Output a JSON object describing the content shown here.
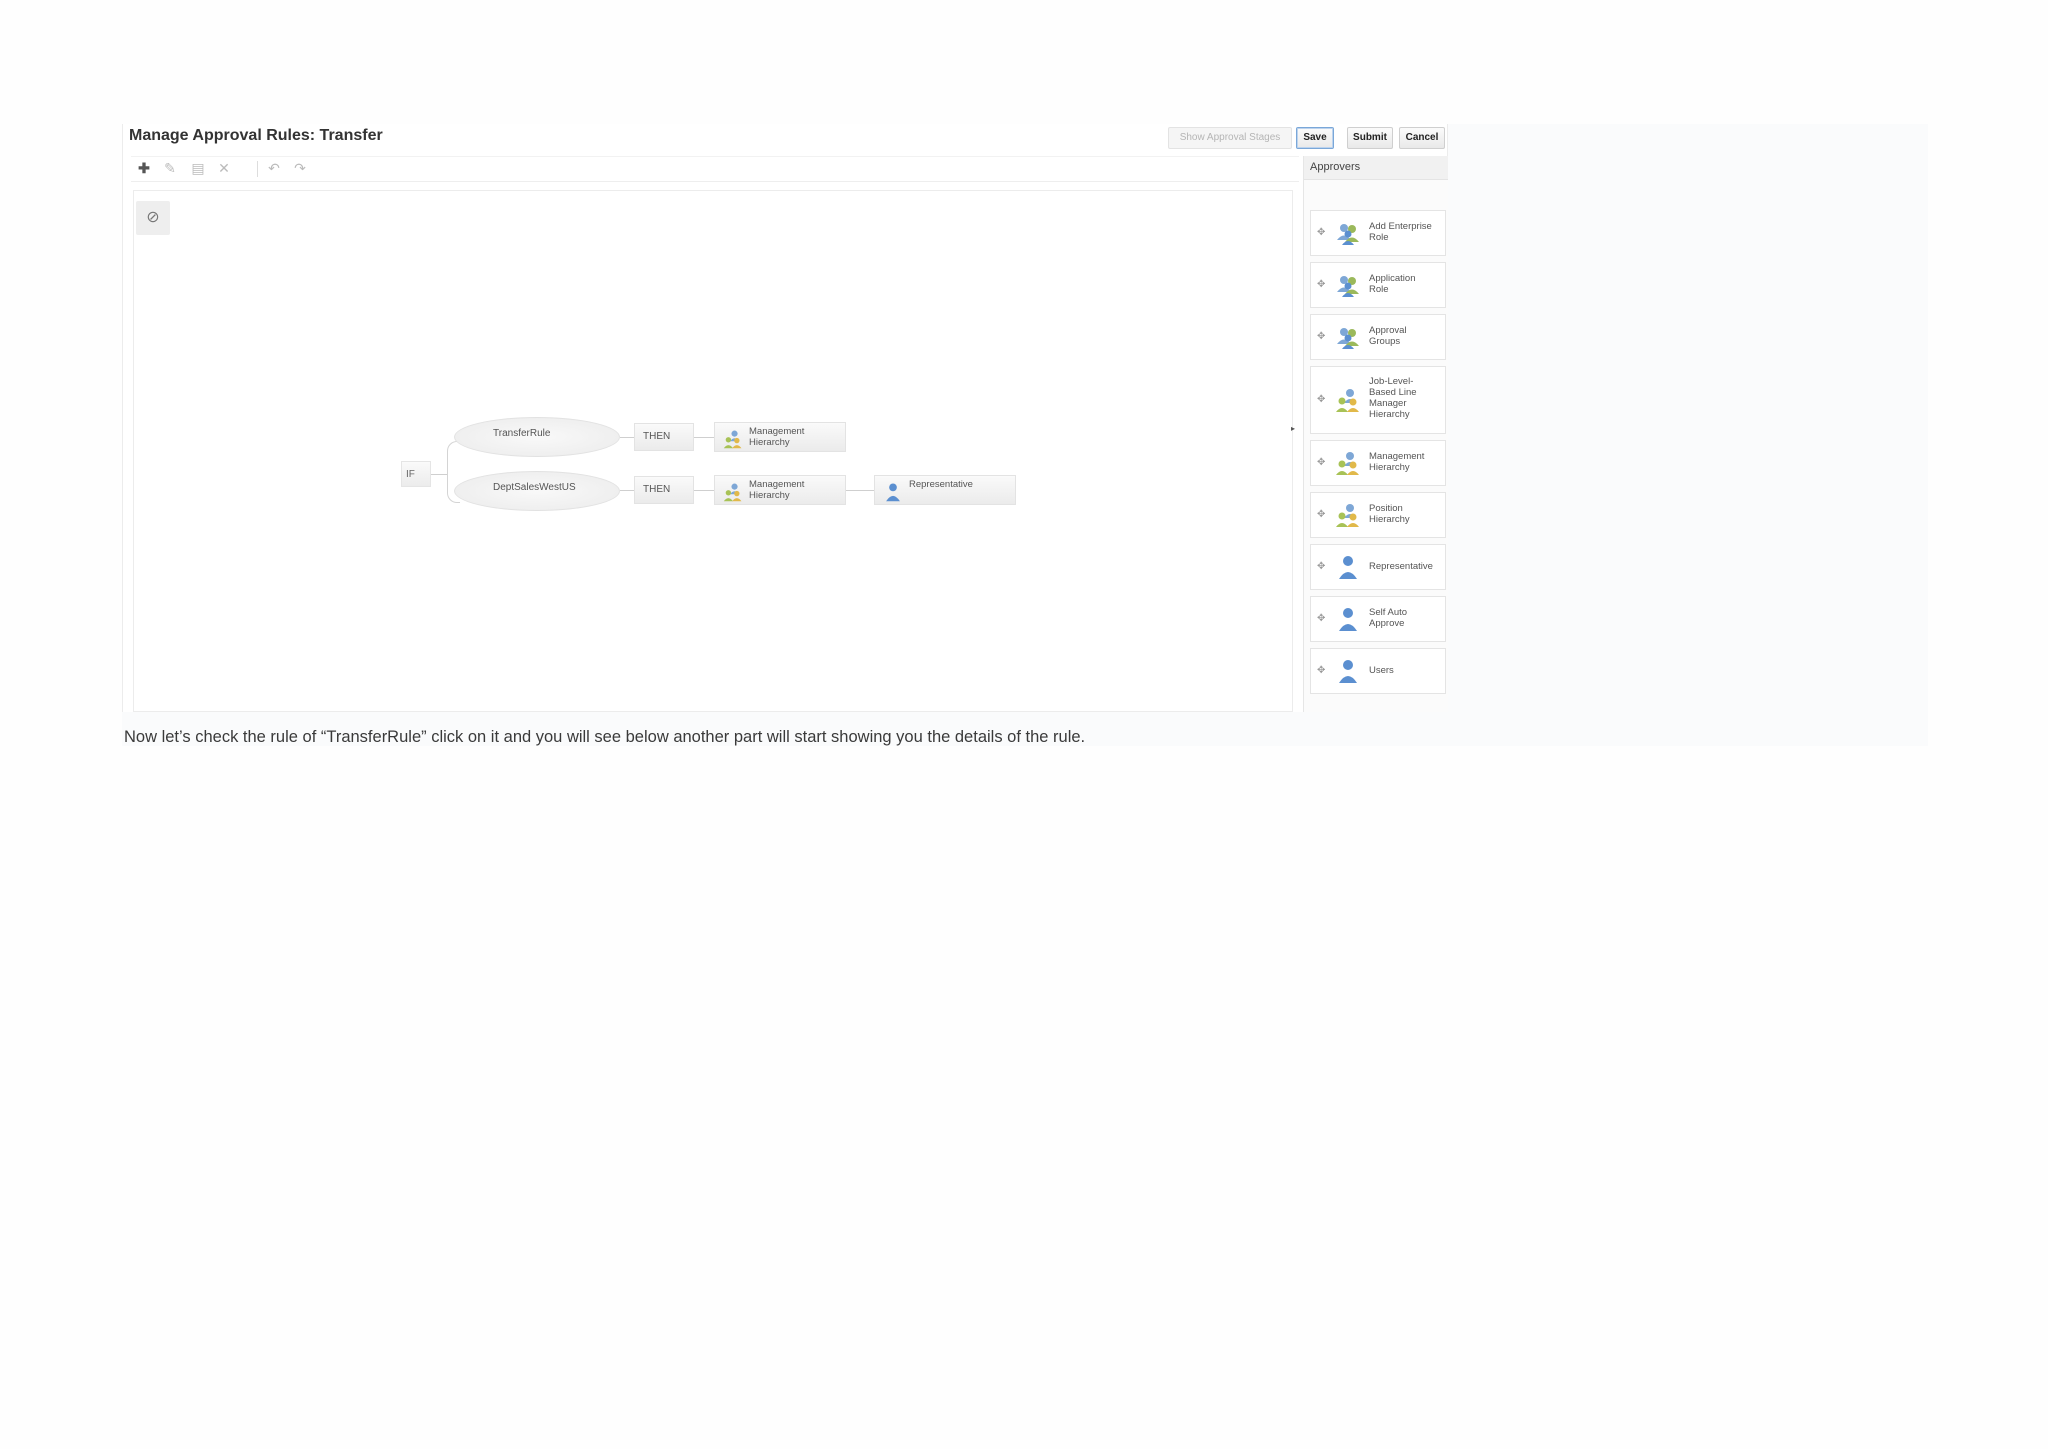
{
  "window": {
    "title": "Manage Approval Rules: Transfer"
  },
  "header_buttons": {
    "show_stages": "Show Approval Stages",
    "save": "Save",
    "submit": "Submit",
    "cancel": "Cancel"
  },
  "toolbar": {
    "icons": [
      "add-icon",
      "edit-icon",
      "copy-icon",
      "delete-icon",
      "undo-icon",
      "redo-icon"
    ]
  },
  "canvas": {
    "if_label": "IF",
    "rules": [
      {
        "name": "TransferRule",
        "then": "THEN",
        "approvers": [
          "Management\nHierarchy"
        ]
      },
      {
        "name": "DeptSalesWestUS",
        "then": "THEN",
        "approvers": [
          "Management\nHierarchy",
          "Representative"
        ]
      }
    ]
  },
  "approvers_panel": {
    "title": "Approvers",
    "items": [
      {
        "label": "Add Enterprise\nRole",
        "icon": "group-icon"
      },
      {
        "label": "Application\nRole",
        "icon": "group-icon"
      },
      {
        "label": "Approval\nGroups",
        "icon": "group-icon"
      },
      {
        "label": "Job-Level-\nBased Line\nManager\nHierarchy",
        "icon": "hierarchy-icon"
      },
      {
        "label": "Management\nHierarchy",
        "icon": "hierarchy-icon"
      },
      {
        "label": "Position\nHierarchy",
        "icon": "hierarchy-icon"
      },
      {
        "label": "Representative",
        "icon": "person-icon"
      },
      {
        "label": "Self Auto\nApprove",
        "icon": "person-icon"
      },
      {
        "label": "Users",
        "icon": "person-icon"
      }
    ]
  },
  "caption": "Now let’s check the rule of “TransferRule” click on it and you will see below another part will start showing you the details of the rule.",
  "colors": {
    "primary_border": "#7aa7d8",
    "node_fill": "#efefef",
    "icon_blue": "#5b8fd0",
    "icon_green": "#8fae3a"
  }
}
